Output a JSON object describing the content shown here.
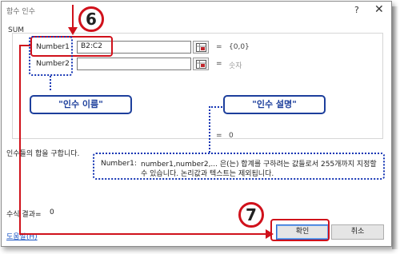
{
  "dialog": {
    "title": "함수 인수",
    "help_glyph": "?",
    "close_glyph": "✕",
    "function_name": "SUM",
    "arguments": [
      {
        "label": "Number1",
        "value": "B2:C2",
        "eq": "=",
        "result": "{0,0}"
      },
      {
        "label": "Number2",
        "value": "",
        "eq": "=",
        "result": "숫자"
      }
    ],
    "total_eq": "=",
    "total_value": "0",
    "description": "인수들의 합을 구합니다.",
    "arg_desc_name": "Number1:",
    "arg_desc_text": "number1,number2,... 은(는) 합계를 구하려는 값들로서 255개까지 지정할 수 있습니다. 논리값과 텍스트는 제외됩니다.",
    "result_label": "수식 결과=",
    "result_value": "0",
    "help_link": "도움말(H)",
    "ok_label": "확인",
    "cancel_label": "취소"
  },
  "annotations": {
    "badge_6": "6",
    "badge_7": "7",
    "callout_arg_name": "\"인수 이름\"",
    "callout_arg_desc": "\"인수 설명\"",
    "colors": {
      "red": "#d0111b",
      "blue": "#1636b4"
    }
  },
  "icons": {
    "ref": "range-select-icon"
  }
}
